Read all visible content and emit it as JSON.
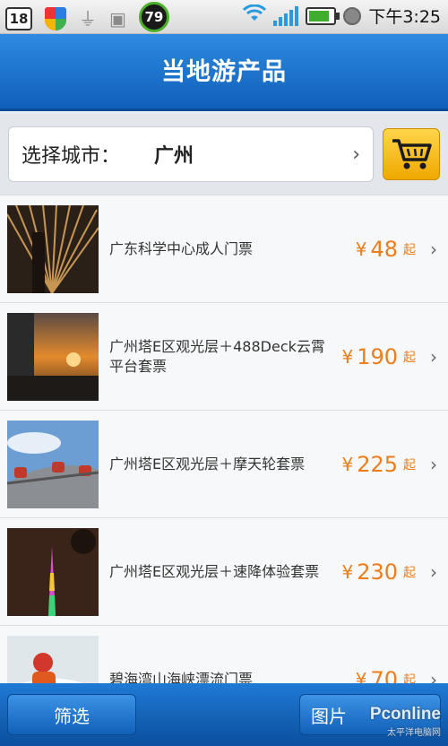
{
  "status_bar": {
    "badge_left": "18",
    "badge_battery_percent": "79",
    "time": "下午3:25"
  },
  "header": {
    "title": "当地游产品"
  },
  "city_picker": {
    "label": "选择城市：",
    "value": "广州"
  },
  "products": [
    {
      "name": "广东科学中心成人门票",
      "price": "48",
      "suffix": "起",
      "currency": "¥"
    },
    {
      "name": "广州塔E区观光层＋488Deck云霄平台套票",
      "price": "190",
      "suffix": "起",
      "currency": "¥"
    },
    {
      "name": "广州塔E区观光层＋摩天轮套票",
      "price": "225",
      "suffix": "起",
      "currency": "¥"
    },
    {
      "name": "广州塔E区观光层＋速降体验套票",
      "price": "230",
      "suffix": "起",
      "currency": "¥"
    },
    {
      "name": "碧海湾山海峡漂流门票",
      "price": "70",
      "suffix": "起",
      "currency": "¥"
    }
  ],
  "bottom_bar": {
    "filter_label": "筛选",
    "image_label": "图片"
  },
  "watermark": {
    "brand": "Pconline",
    "sub": "太平洋电脑网"
  },
  "colors": {
    "header_blue": "#1a6fcc",
    "price_orange": "#ee7d1c",
    "cart_yellow": "#f6b800"
  }
}
